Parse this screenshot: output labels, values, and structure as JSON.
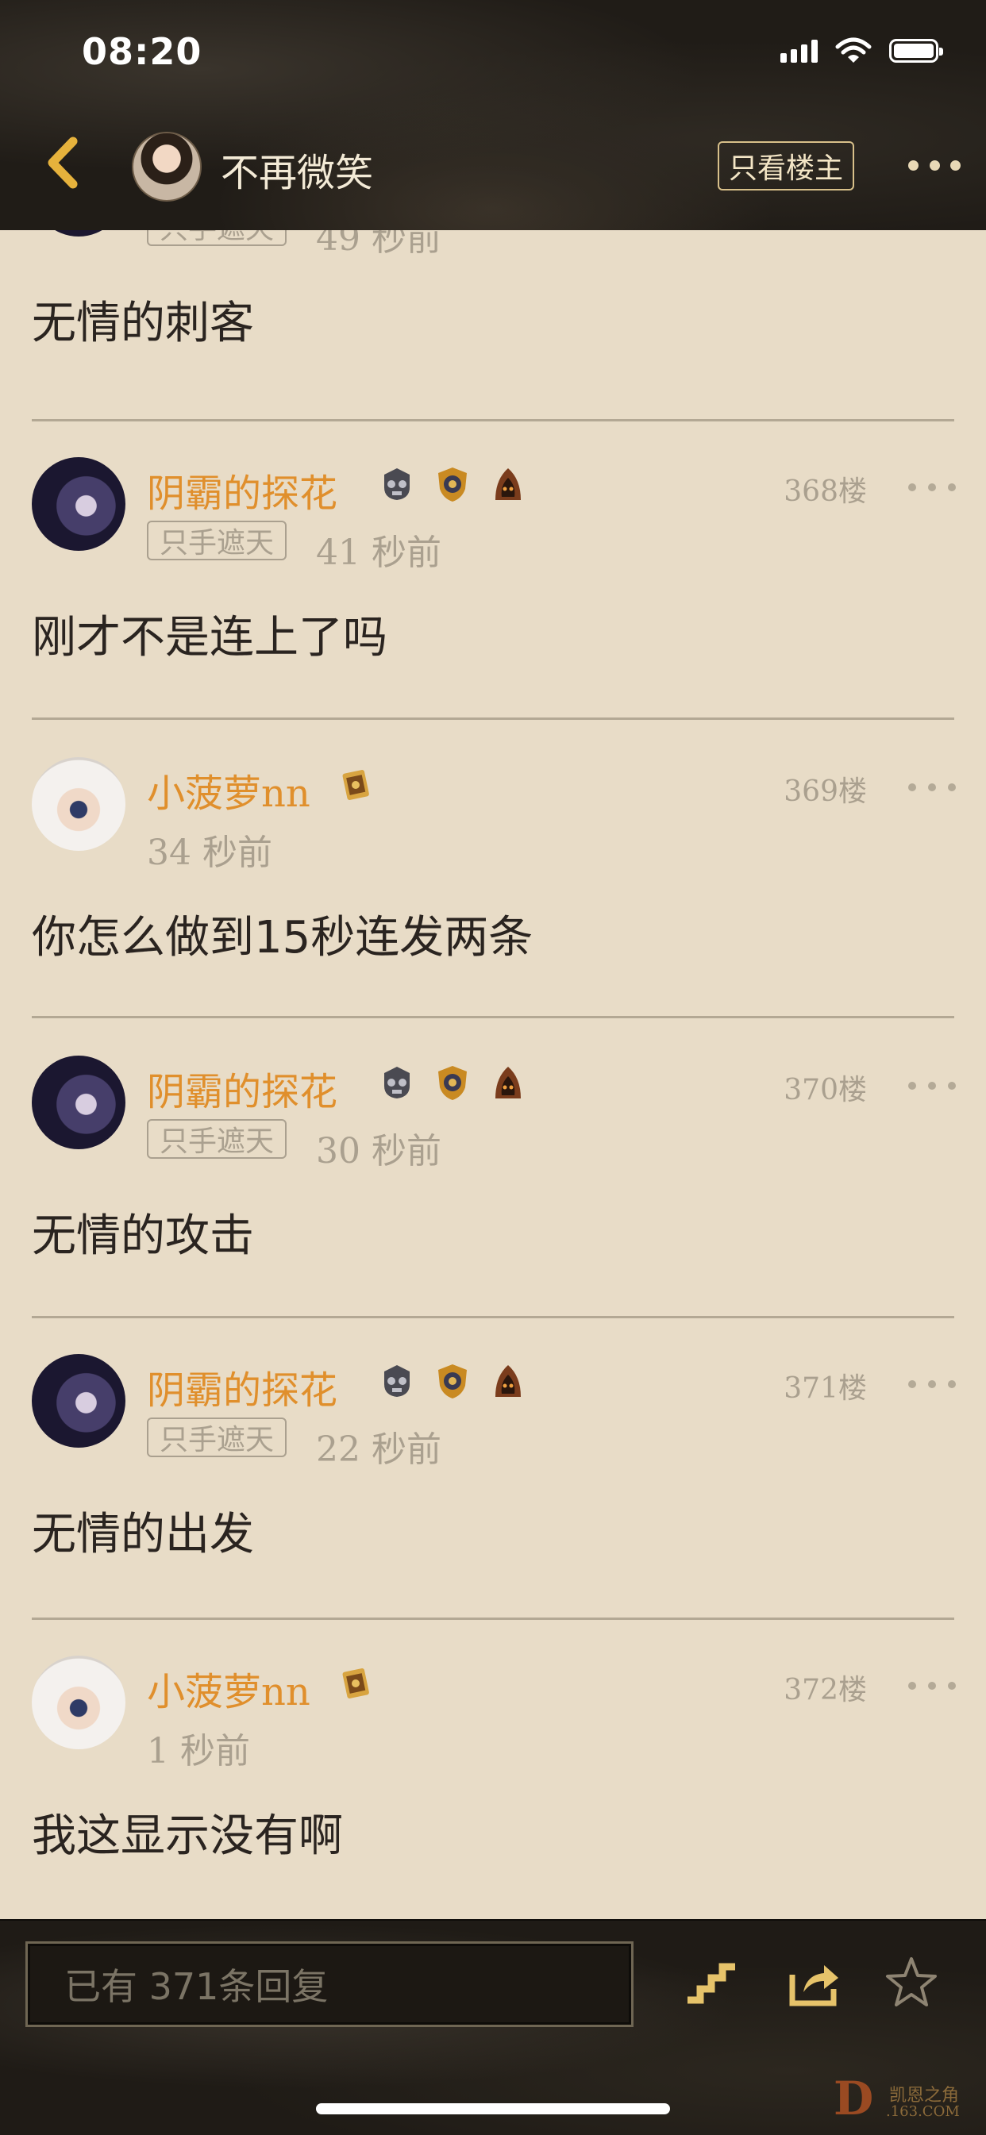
{
  "status_bar": {
    "time": "08:20"
  },
  "header": {
    "thread_author": "不再微笑",
    "only_op_label": "只看楼主"
  },
  "partial_post": {
    "tag": "只手遮天",
    "time": "49 秒前",
    "text": "无情的刺客"
  },
  "posts": [
    {
      "username": "阴霸的探花",
      "floor": "368楼",
      "tag": "只手遮天",
      "time": "41 秒前",
      "text": "刚才不是连上了吗",
      "badges": [
        "skull-badge-icon",
        "shield-badge-icon",
        "hood-badge-icon"
      ]
    },
    {
      "username": "小菠萝nn",
      "floor": "369楼",
      "tag": "",
      "time": "34 秒前",
      "text": "你怎么做到15秒连发两条",
      "badges": [
        "scroll-badge-icon"
      ]
    },
    {
      "username": "阴霸的探花",
      "floor": "370楼",
      "tag": "只手遮天",
      "time": "30 秒前",
      "text": "无情的攻击",
      "badges": [
        "skull-badge-icon",
        "shield-badge-icon",
        "hood-badge-icon"
      ]
    },
    {
      "username": "阴霸的探花",
      "floor": "371楼",
      "tag": "只手遮天",
      "time": "22 秒前",
      "text": "无情的出发",
      "badges": [
        "skull-badge-icon",
        "shield-badge-icon",
        "hood-badge-icon"
      ]
    },
    {
      "username": "小菠萝nn",
      "floor": "372楼",
      "tag": "",
      "time": "1 秒前",
      "text": "我这显示没有啊",
      "badges": [
        "scroll-badge-icon"
      ]
    }
  ],
  "bottom_bar": {
    "reply_placeholder": "已有 371条回复",
    "icons": [
      "stairs-icon",
      "share-icon",
      "star-icon"
    ]
  },
  "watermark": {
    "mark": "D",
    "line1": "凯恩之角",
    "line2": ".163.COM"
  },
  "colors": {
    "username": "#e08f2c",
    "background": "#e8dcc7",
    "meta": "#aaa08f"
  }
}
